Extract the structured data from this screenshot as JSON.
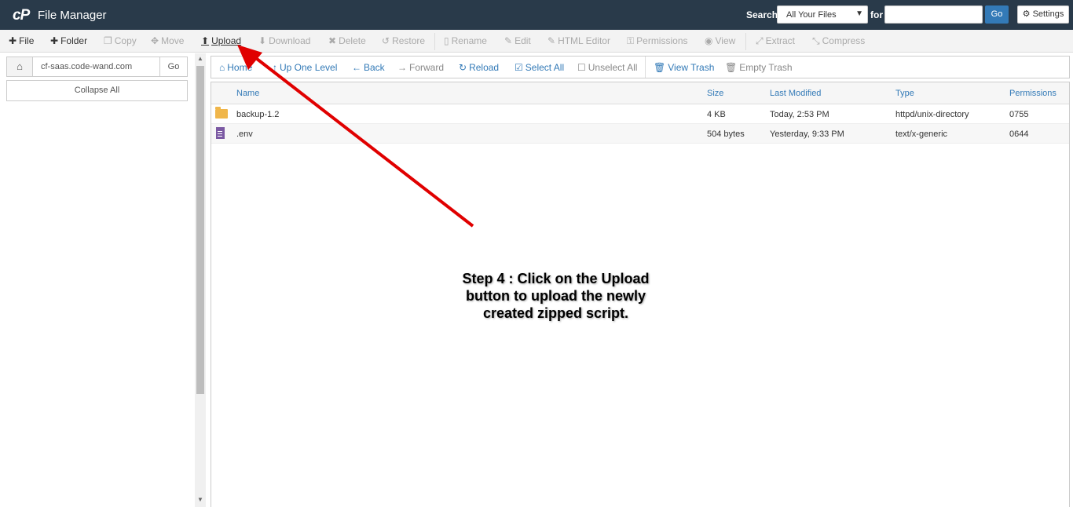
{
  "header": {
    "logo": "cP",
    "title": "File Manager",
    "search_label": "Search",
    "search_scope": "All Your Files",
    "for_label": "for",
    "search_value": "",
    "go_label": "Go",
    "settings_label": "Settings",
    "bg_color": "#293a4a",
    "accent_color": "#337ab7"
  },
  "toolbar": {
    "file": "File",
    "folder": "Folder",
    "copy": "Copy",
    "move": "Move",
    "upload": "Upload",
    "download": "Download",
    "delete": "Delete",
    "restore": "Restore",
    "rename": "Rename",
    "edit": "Edit",
    "html_editor": "HTML Editor",
    "permissions": "Permissions",
    "view": "View",
    "extract": "Extract",
    "compress": "Compress"
  },
  "sidebar": {
    "path": "cf-saas.code-wand.com",
    "go_label": "Go",
    "collapse_label": "Collapse All"
  },
  "nav": {
    "home": "Home",
    "up": "Up One Level",
    "back": "Back",
    "forward": "Forward",
    "reload": "Reload",
    "select_all": "Select All",
    "unselect_all": "Unselect All",
    "view_trash": "View Trash",
    "empty_trash": "Empty Trash"
  },
  "table": {
    "columns": {
      "name": "Name",
      "size": "Size",
      "modified": "Last Modified",
      "type": "Type",
      "perms": "Permissions"
    },
    "rows": [
      {
        "name": "backup-1.2",
        "size": "4 KB",
        "modified": "Today, 2:53 PM",
        "type": "httpd/unix-directory",
        "perms": "0755",
        "icon": "folder-icon"
      },
      {
        "name": ".env",
        "size": "504 bytes",
        "modified": "Yesterday, 9:33 PM",
        "type": "text/x-generic",
        "perms": "0644",
        "icon": "file-icon"
      }
    ]
  },
  "annotation": {
    "line1": "Step 4 : Click on the Upload",
    "line2": "button to upload the newly",
    "line3": "created zipped script.",
    "arrow_color": "#e00000"
  }
}
